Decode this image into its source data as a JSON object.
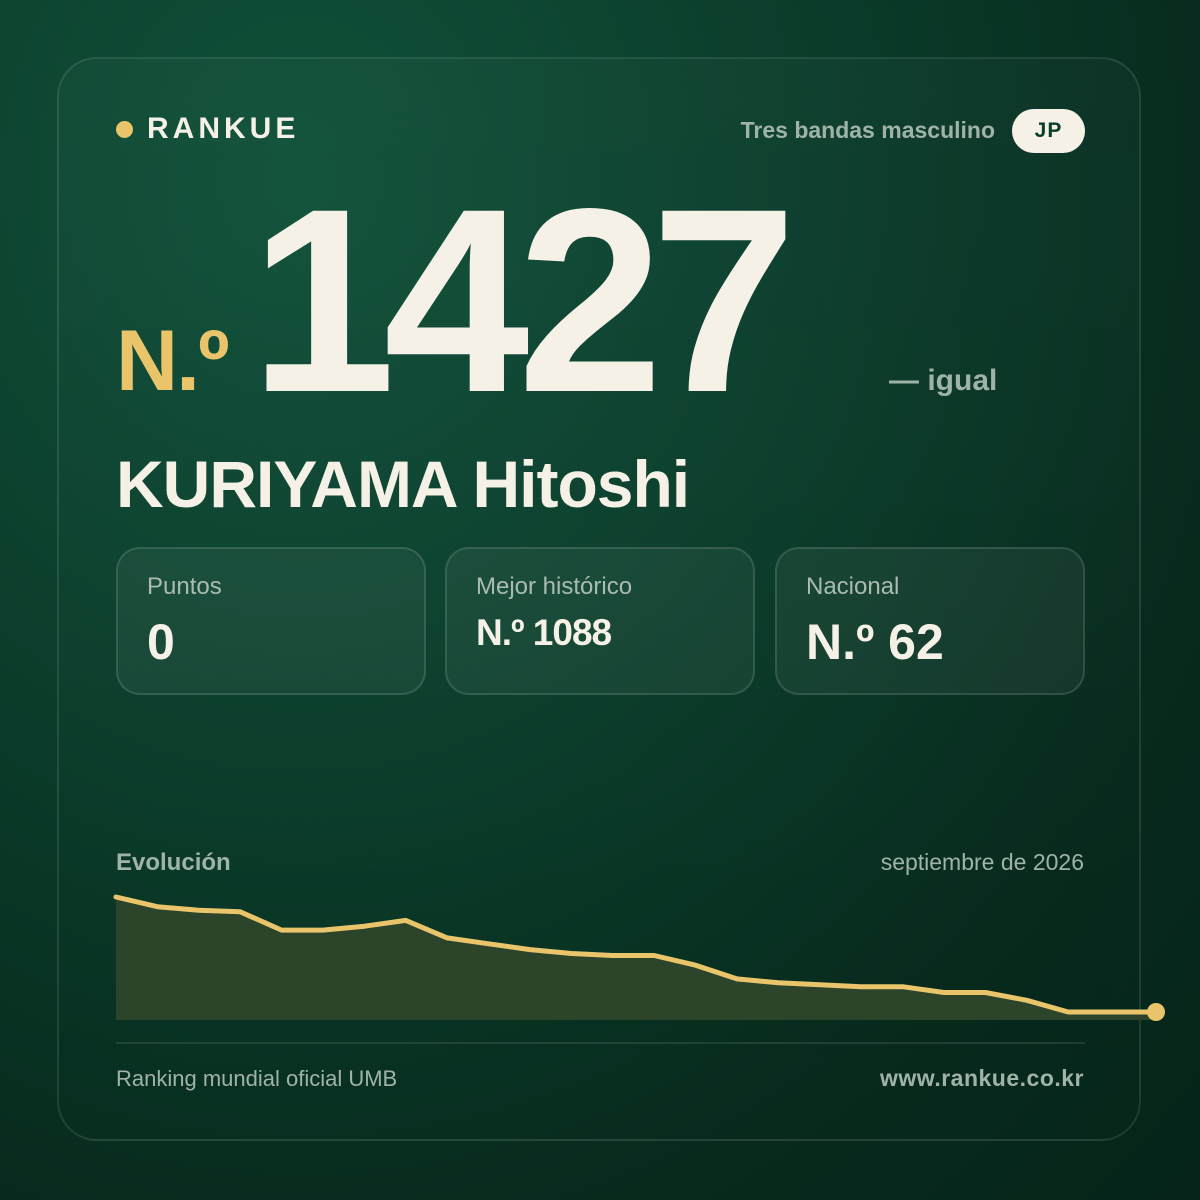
{
  "brand": {
    "name": "RANKUE",
    "dot_color": "#e9c46a"
  },
  "header": {
    "category": "Tres bandas masculino",
    "country_code": "JP"
  },
  "rank": {
    "prefix": "N.º",
    "number": "1427",
    "change": "— igual"
  },
  "player": {
    "name": "KURIYAMA Hitoshi"
  },
  "stats": [
    {
      "label": "Puntos",
      "value": "0"
    },
    {
      "label": "Mejor histórico",
      "value": "N.º 1088"
    },
    {
      "label": "Nacional",
      "value": "N.º 62"
    }
  ],
  "evolution": {
    "title": "Evolución",
    "date": "septiembre de 2026"
  },
  "chart_data": {
    "type": "area",
    "rank_series": [
      1088,
      1113,
      1122,
      1126,
      1173,
      1173,
      1163,
      1148,
      1193,
      1208,
      1223,
      1233,
      1238,
      1238,
      1263,
      1298,
      1308,
      1313,
      1318,
      1318,
      1333,
      1333,
      1353,
      1383,
      1383,
      1383
    ],
    "inverted": true,
    "rank_range": [
      1088,
      1427
    ],
    "line_color": "#e9c46a",
    "fill_color": "#2c4429",
    "grid": false
  },
  "footer": {
    "source": "Ranking mundial oficial UMB",
    "url": "www.rankue.co.kr"
  }
}
